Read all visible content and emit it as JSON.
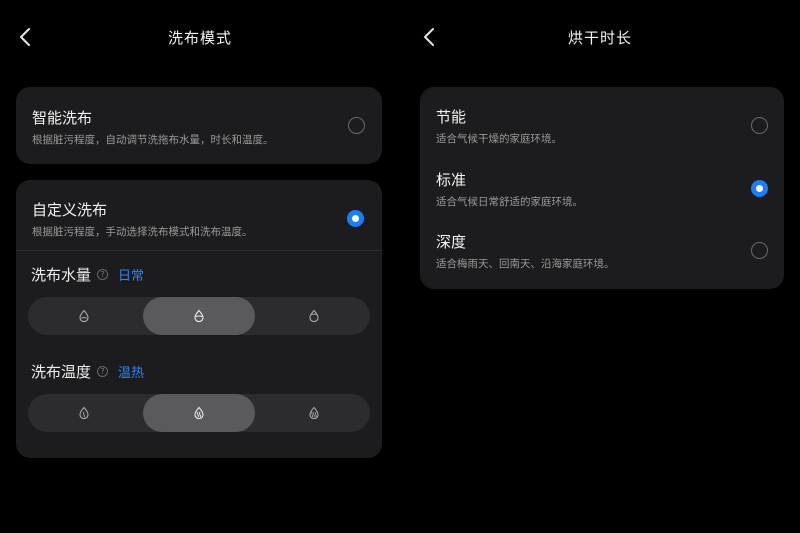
{
  "wash": {
    "title": "洗布模式",
    "smart": {
      "title": "智能洗布",
      "desc": "根据脏污程度，自动调节洗拖布水量，时长和温度。"
    },
    "custom": {
      "title": "自定义洗布",
      "desc": "根据脏污程度，手动选择洗布模式和洗布温度。",
      "water": {
        "label": "洗布水量",
        "value": "日常",
        "options": [
          "water-low-icon",
          "water-medium-icon",
          "water-high-icon"
        ],
        "selected": 1
      },
      "temp": {
        "label": "洗布温度",
        "value": "温热",
        "options": [
          "temp-normal-icon",
          "temp-warm-icon",
          "temp-hot-icon"
        ],
        "selected": 1
      }
    },
    "selected": "custom"
  },
  "dry": {
    "title": "烘干时长",
    "options": [
      {
        "title": "节能",
        "desc": "适合气候干燥的家庭环境。"
      },
      {
        "title": "标准",
        "desc": "适合气候日常舒适的家庭环境。"
      },
      {
        "title": "深度",
        "desc": "适合梅雨天、回南天、沿海家庭环境。"
      }
    ],
    "selected": 1
  },
  "colors": {
    "accent": "#1a7ef5",
    "card": "#1c1c1e",
    "segment": "#2c2c2e",
    "segment_selected": "#5a5a5c",
    "value_text": "#2b86f0"
  },
  "info_glyph": "?"
}
